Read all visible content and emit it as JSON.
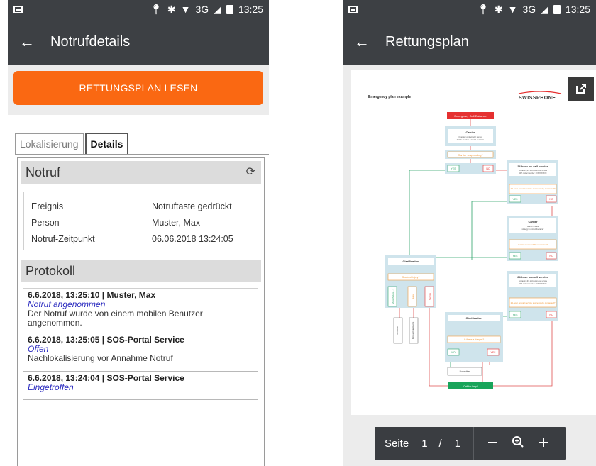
{
  "left": {
    "status": {
      "network": "3G",
      "time": "13:25"
    },
    "appbar": {
      "back": "←",
      "title": "Notrufdetails"
    },
    "action_button": "RETTUNGSPLAN LESEN",
    "tabs": [
      {
        "label": "Lokalisierung"
      },
      {
        "label": "Details"
      }
    ],
    "notruf": {
      "heading": "Notruf",
      "rows": [
        {
          "key": "Ereignis",
          "value": "Notruftaste gedrückt"
        },
        {
          "key": "Person",
          "value": "Muster, Max"
        },
        {
          "key": "Notruf-Zeitpunkt",
          "value": "06.06.2018 13:24:05"
        }
      ]
    },
    "protokoll": {
      "heading": "Protokoll",
      "entries": [
        {
          "header": "6.6.2018, 13:25:10 | Muster, Max",
          "state": "Notruf angenommen",
          "detail": "Der Notruf wurde von einem mobilen Benutzer angenommen."
        },
        {
          "header": "6.6.2018, 13:25:05 | SOS-Portal Service",
          "state": "Offen",
          "detail": "Nachlokalisierung vor Annahme Notruf"
        },
        {
          "header": "6.6.2018, 13:24:04 | SOS-Portal Service",
          "state": "Eingetroffen",
          "detail": ""
        }
      ]
    }
  },
  "right": {
    "status": {
      "network": "3G",
      "time": "13:25"
    },
    "appbar": {
      "back": "←",
      "title": "Rettungsplan"
    },
    "document": {
      "title": "Emergency plan example",
      "brand": "SWISSPHONE",
      "nodes": {
        "entrance": "Emergency Call Entrance",
        "carrier1": "Carrier",
        "carrier1_sub1": "Operator contact with sensor",
        "carrier1_sub2": "Mobile number 1 level 1 available",
        "carrier_responding": "Carrier responding?",
        "yes1": "YES",
        "no1": "NO",
        "svc1": "24-hour on-call service",
        "svc1_sub1": "Contacting the 24-hour on-call service",
        "svc1_sub2": "24/7 contact number: XXXXXXXXXX",
        "svc1_q": "24-hour on-call service successfully contacted?",
        "yes2": "YES",
        "no2": "NO",
        "carrier2": "Carrier",
        "carrier2_sub1": "After 5 minutes",
        "carrier2_sub2": "strategy to contact the carrier",
        "carrier2_q": "Carrier successfully contacted?",
        "yes3": "YES",
        "no3": "NO",
        "svc2": "24-hour on-call service",
        "svc2_sub1": "Contacting the 24-hour on-call service",
        "svc2_sub2": "24/7 contact number: XXXXXXXXXX",
        "svc2_q": "24-hour on-call service successfully contacted?",
        "yes4": "YES",
        "no4": "NO",
        "clar1": "Clarification",
        "grade": "Grade of injury?",
        "opt_more": "More (failure ...)",
        "opt_easy": "Easy",
        "opt_service": "Service",
        "res_noaction": "No action",
        "res_phone": "First aid via phone",
        "clar2": "Clarification",
        "danger": "Is there a danger?",
        "yes5": "NO",
        "no5": "YES",
        "noaction2": "No action",
        "callhelp": "Call for help!"
      }
    },
    "pager": {
      "label": "Seite",
      "current": "1",
      "sep": "/",
      "total": "1"
    }
  }
}
